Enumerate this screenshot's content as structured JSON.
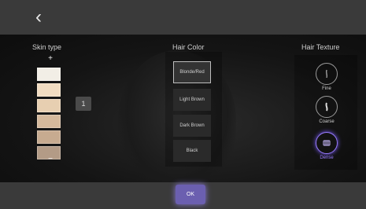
{
  "header": {
    "back_icon": "chevron-left-icon"
  },
  "skin_type": {
    "title": "Skin type",
    "plus": "+",
    "minus": "−",
    "indicator": "1",
    "swatches": [
      "#f2eee6",
      "#f1dcc1",
      "#e7cfb1",
      "#d5b99c",
      "#c7ab90",
      "#b39b86"
    ]
  },
  "hair_color": {
    "title": "Hair Color",
    "options": [
      "Blonde/Red",
      "Light Brown",
      "Dark Brown",
      "Black"
    ],
    "selected": "Blonde/Red"
  },
  "hair_texture": {
    "title": "Hair Texture",
    "options": [
      {
        "label": "Fine",
        "icon": "fine-hair-icon"
      },
      {
        "label": "Coarse",
        "icon": "coarse-hair-icon"
      },
      {
        "label": "Dense",
        "icon": "dense-hair-icon"
      }
    ],
    "selected": "Dense",
    "accent": "#9a7cff"
  },
  "footer": {
    "ok_label": "OK",
    "ok_color": "#6b5fb0"
  }
}
